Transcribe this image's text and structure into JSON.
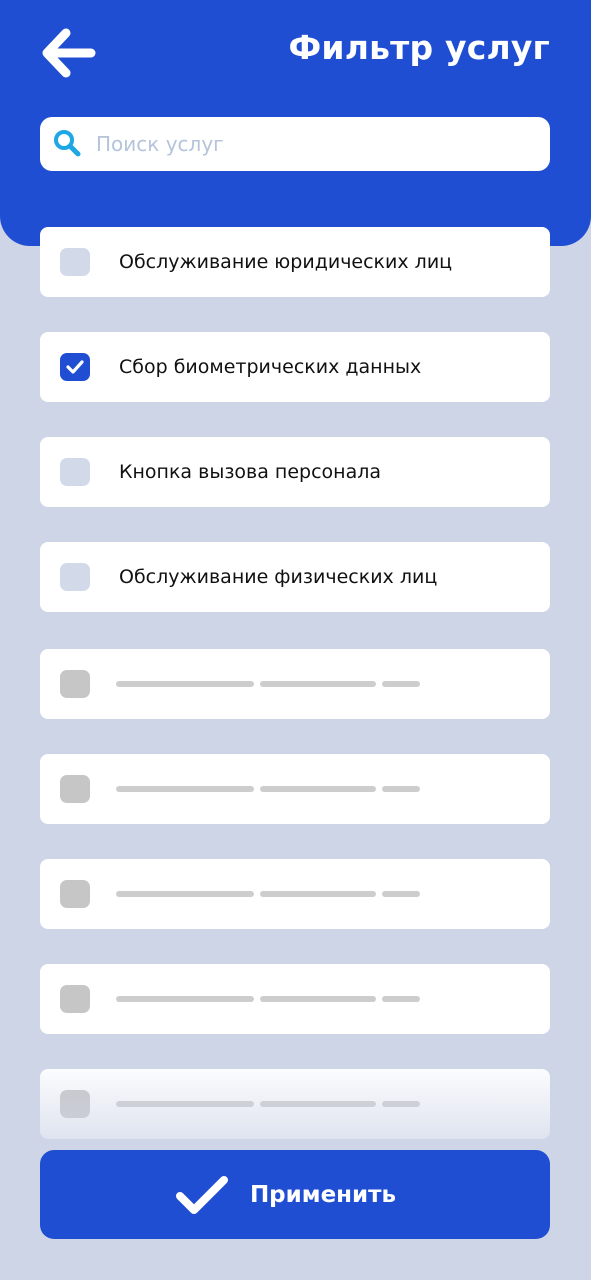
{
  "header": {
    "title": "Фильтр услуг",
    "back_icon": "arrow-left-icon",
    "color": "#1F4ED3"
  },
  "search": {
    "placeholder": "Поиск услуг",
    "value": "",
    "icon": "search-icon",
    "icon_color": "#1EA7E4"
  },
  "services": [
    {
      "label": "Обслуживание юридических лиц",
      "checked": false
    },
    {
      "label": "Сбор биометрических данных",
      "checked": true
    },
    {
      "label": "Кнопка вызова персонала",
      "checked": false
    },
    {
      "label": "Обслуживание физических лиц",
      "checked": false
    }
  ],
  "placeholder_rows": 5,
  "apply": {
    "label": "Применить",
    "icon": "check-icon"
  }
}
